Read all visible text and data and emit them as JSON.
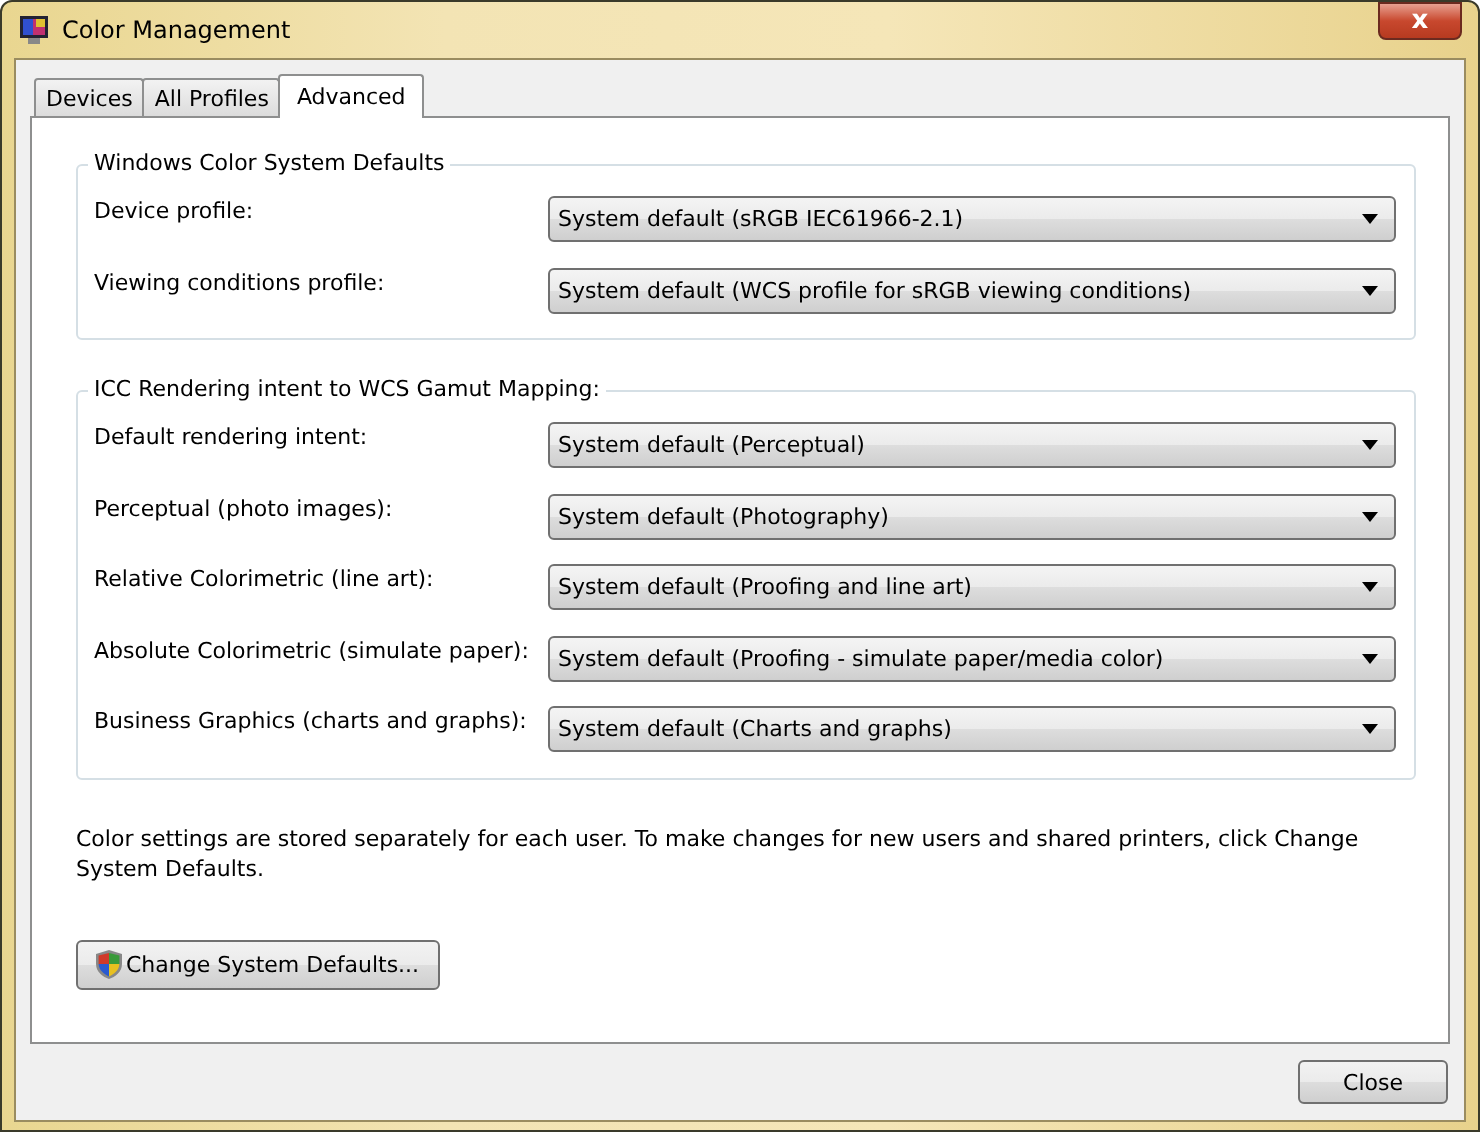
{
  "window": {
    "title": "Color Management",
    "close_glyph": "x"
  },
  "tabs": [
    {
      "label": "Devices",
      "selected": false
    },
    {
      "label": "All Profiles",
      "selected": false
    },
    {
      "label": "Advanced",
      "selected": true
    }
  ],
  "groups": [
    {
      "title": "Windows Color System Defaults",
      "rows": [
        {
          "label": "Device profile:",
          "value": "System default (sRGB IEC61966-2.1)"
        },
        {
          "label": "Viewing conditions profile:",
          "value": "System default (WCS profile for sRGB viewing conditions)"
        }
      ]
    },
    {
      "title": "ICC Rendering intent to WCS Gamut Mapping:",
      "rows": [
        {
          "label": "Default rendering intent:",
          "value": "System default (Perceptual)"
        },
        {
          "label": "Perceptual (photo images):",
          "value": "System default (Photography)"
        },
        {
          "label": "Relative Colorimetric (line art):",
          "value": "System default (Proofing and line art)"
        },
        {
          "label": "Absolute Colorimetric (simulate paper):",
          "value": "System default (Proofing - simulate paper/media color)"
        },
        {
          "label": "Business Graphics (charts and graphs):",
          "value": "System default (Charts and graphs)"
        }
      ]
    }
  ],
  "note": "Color settings are stored separately for each user. To make changes for new users and shared printers, click Change System Defaults.",
  "change_button": "Change System Defaults...",
  "close_button": "Close"
}
